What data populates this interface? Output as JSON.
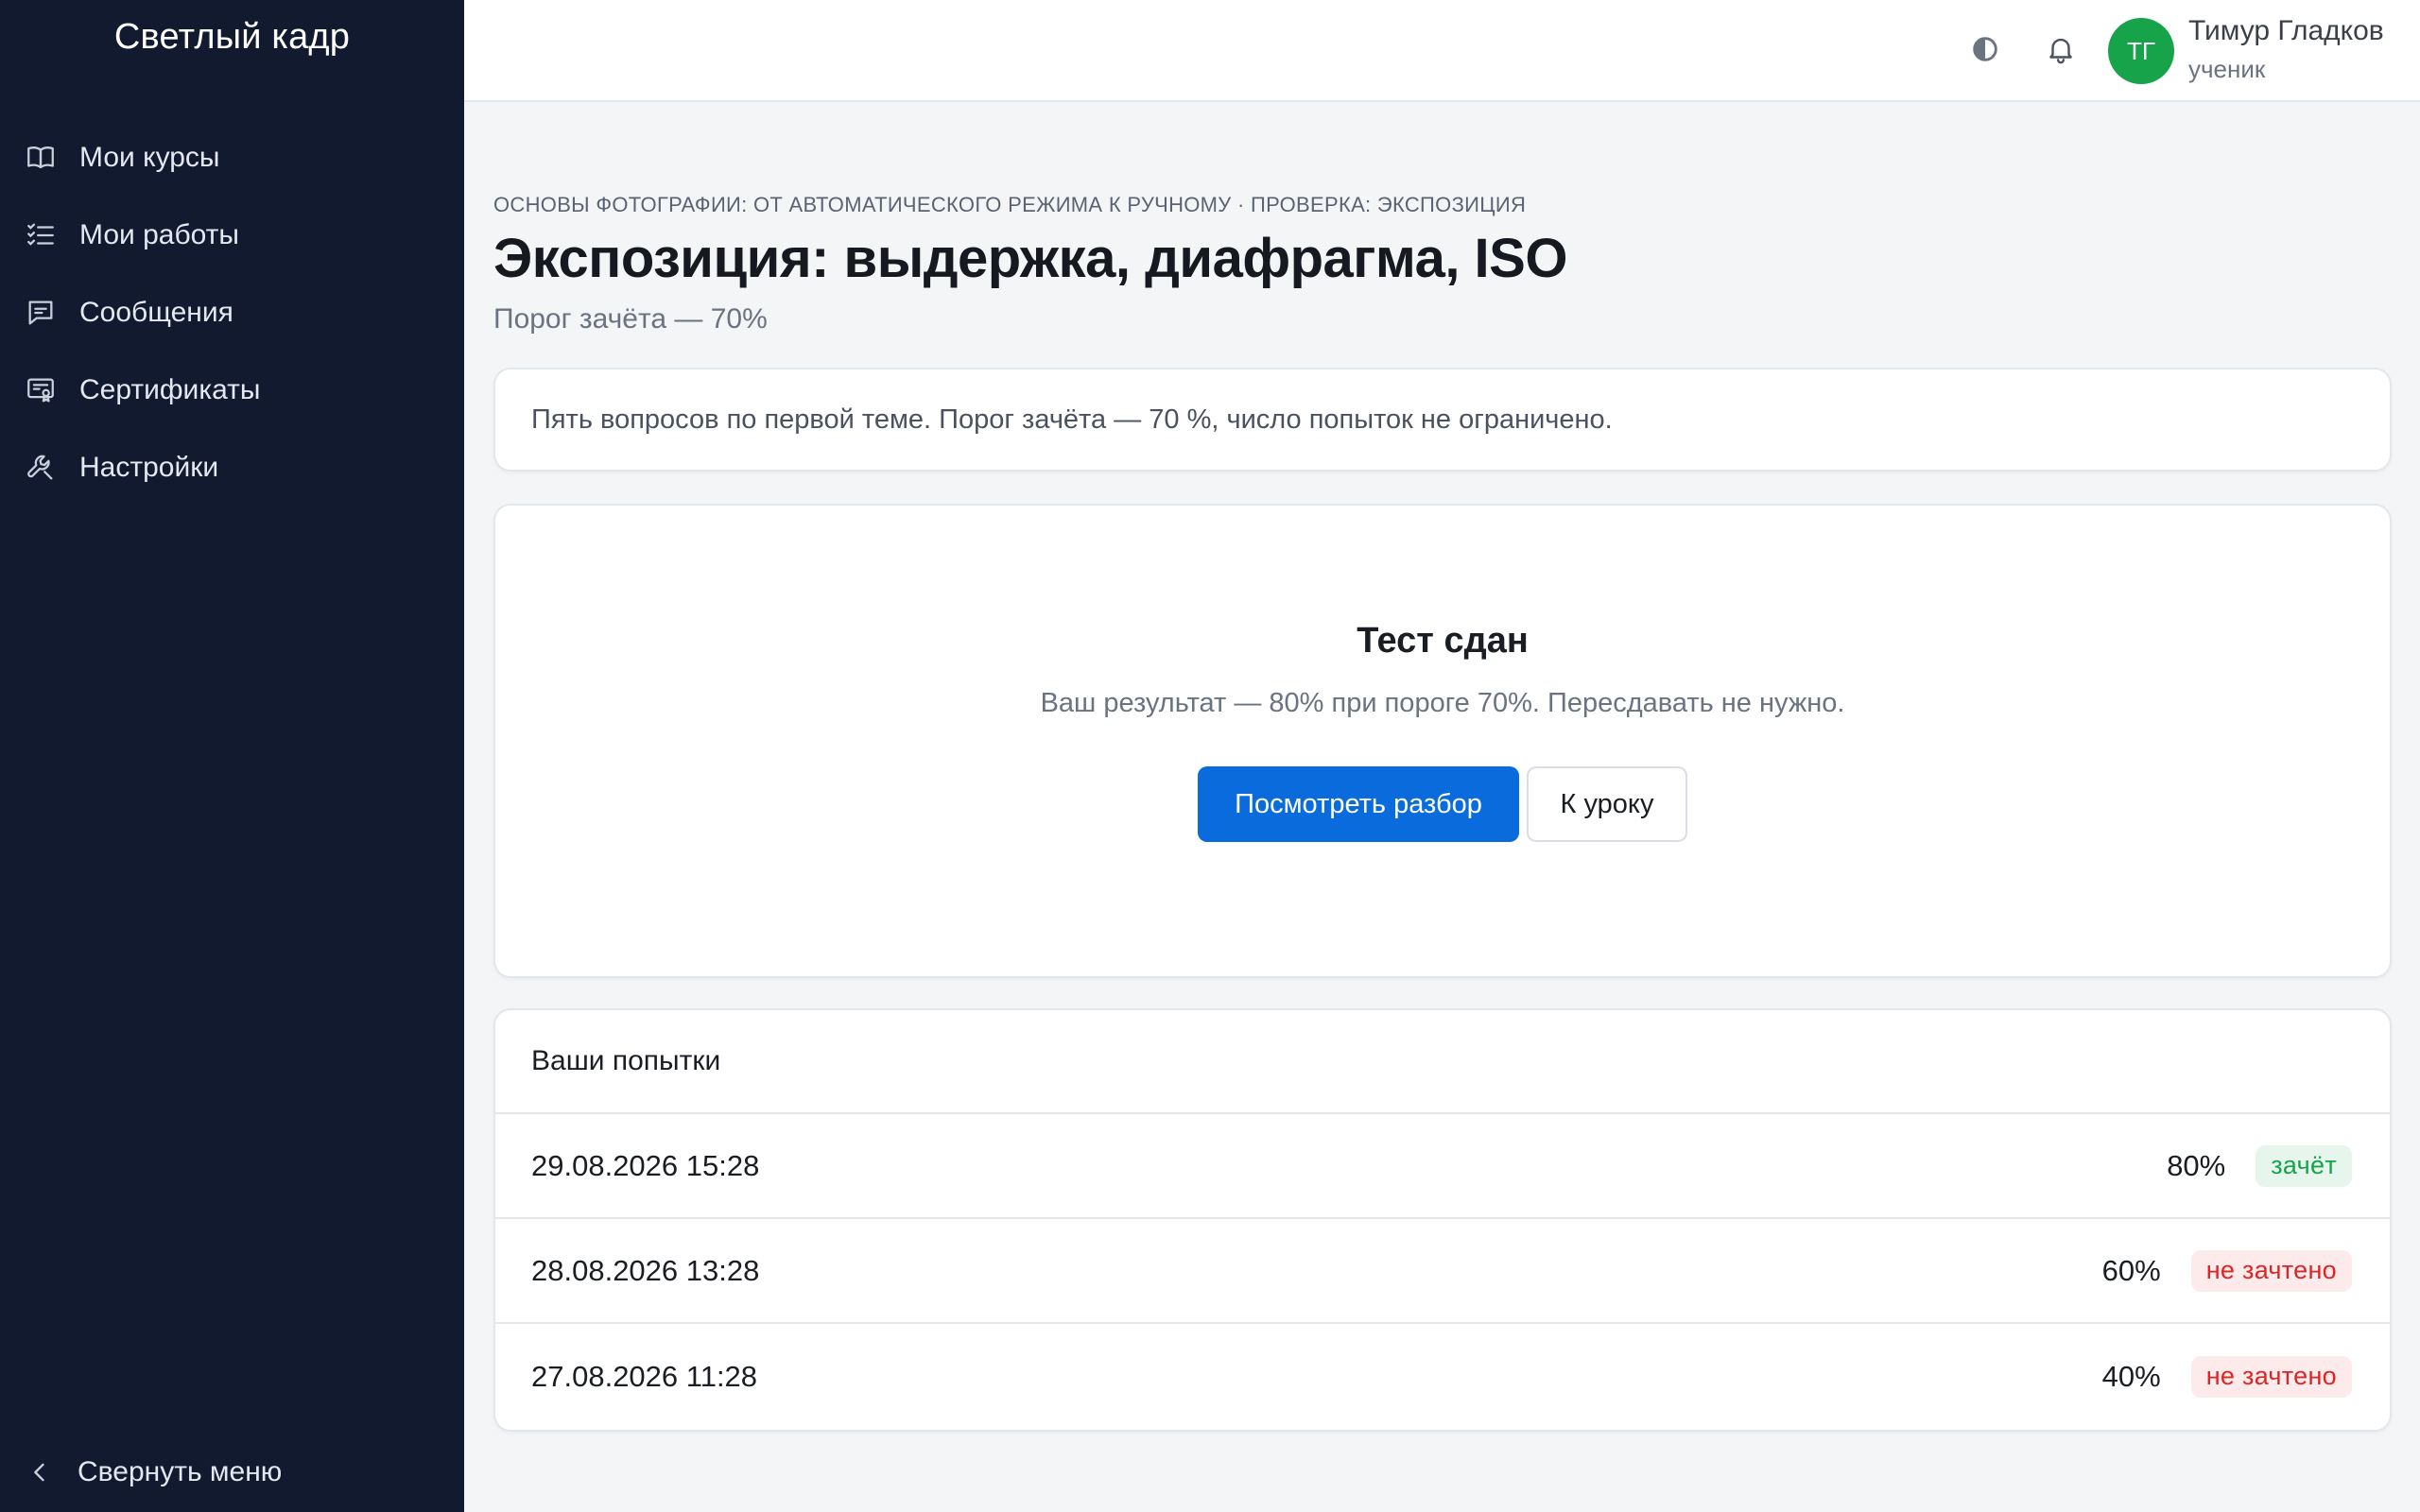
{
  "app": {
    "brand": "Светлый кадр"
  },
  "sidebar": {
    "items": [
      {
        "label": "Мои курсы",
        "icon": "book-icon"
      },
      {
        "label": "Мои работы",
        "icon": "checklist-icon"
      },
      {
        "label": "Сообщения",
        "icon": "message-icon"
      },
      {
        "label": "Сертификаты",
        "icon": "certificate-icon"
      },
      {
        "label": "Настройки",
        "icon": "wrench-icon"
      }
    ],
    "collapse_label": "Свернуть меню"
  },
  "topbar": {
    "user": {
      "initials": "ТГ",
      "name": "Тимур Гладков",
      "role": "ученик"
    },
    "avatar_color": "#16a34a"
  },
  "page": {
    "breadcrumb": "Основы фотографии: от автоматического режима к ручному · Проверка: экспозиция",
    "title": "Экспозиция: выдержка, диафрагма, ISO",
    "subtitle": "Порог зачёта — 70%",
    "description": "Пять вопросов по первой теме. Порог зачёта — 70 %, число попыток не ограничено."
  },
  "result": {
    "title": "Тест сдан",
    "text": "Ваш результат — 80% при пороге 70%. Пересдавать не нужно.",
    "primary_button": "Посмотреть разбор",
    "secondary_button": "К уроку",
    "accent_color": "#0a6cdc"
  },
  "attempts": {
    "title": "Ваши попытки",
    "rows": [
      {
        "date": "29.08.2026 15:28",
        "score": "80%",
        "status": "зачёт",
        "status_type": "pass"
      },
      {
        "date": "28.08.2026 13:28",
        "score": "60%",
        "status": "не зачтено",
        "status_type": "fail"
      },
      {
        "date": "27.08.2026 11:28",
        "score": "40%",
        "status": "не зачтено",
        "status_type": "fail"
      }
    ]
  }
}
